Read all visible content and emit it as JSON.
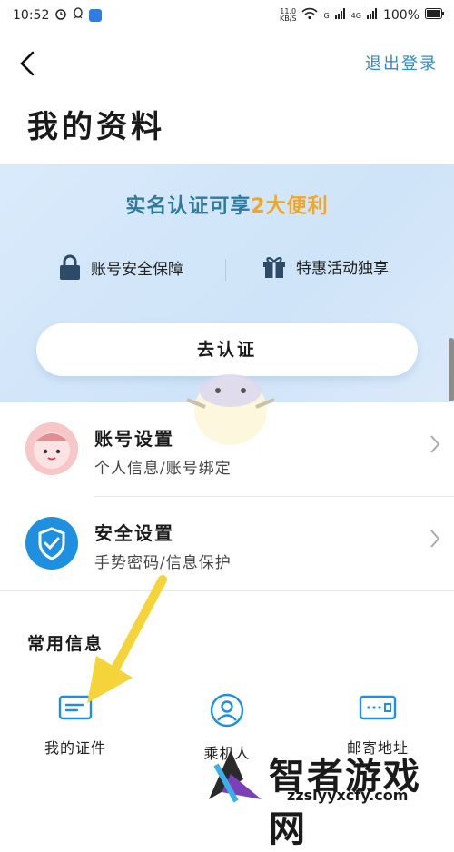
{
  "status_bar": {
    "time": "10:52",
    "net_speed_value": "11.0",
    "net_speed_unit": "KB/S",
    "signal1_label": "G",
    "signal2_label": "4G",
    "battery": "100%"
  },
  "header": {
    "logout_label": "退出登录"
  },
  "page_title": "我的资料",
  "banner": {
    "headline_prefix": "实名认证可享",
    "headline_highlight": "2大便利",
    "benefit1": "账号安全保障",
    "benefit2": "特惠活动独享",
    "certify_button": "去认证"
  },
  "settings": [
    {
      "title": "账号设置",
      "subtitle": "个人信息/账号绑定"
    },
    {
      "title": "安全设置",
      "subtitle": "手势密码/信息保护"
    }
  ],
  "common_info": {
    "section_title": "常用信息",
    "items": [
      {
        "label": "我的证件",
        "icon": "id-card-icon"
      },
      {
        "label": "乘机人",
        "icon": "passenger-icon"
      },
      {
        "label": "邮寄地址",
        "icon": "address-card-icon"
      }
    ]
  },
  "watermark": {
    "brand": "智者游戏网",
    "url": "zzslyyxcfy.com"
  },
  "colors": {
    "accent": "#2f8bc9",
    "highlight": "#f3a623",
    "banner_bg": "#d9eafb",
    "icon_blue": "#1f8fe0",
    "arrow_yellow": "#f5d43a"
  }
}
